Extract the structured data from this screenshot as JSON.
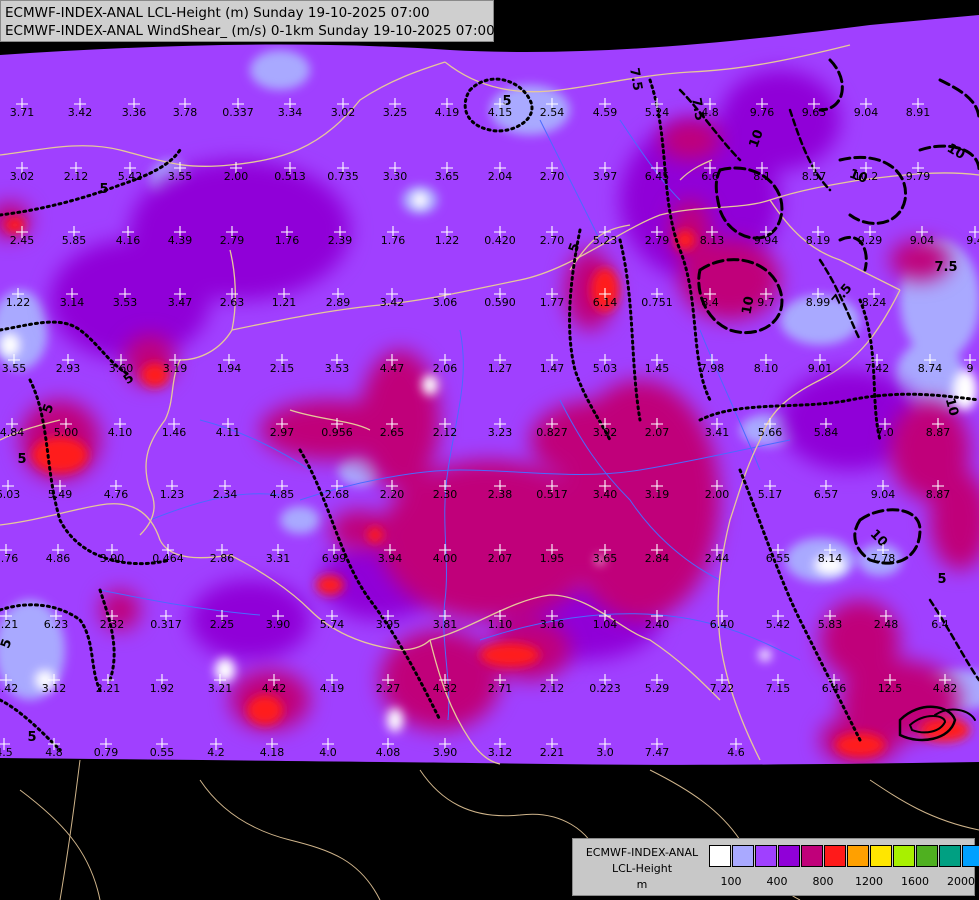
{
  "title": {
    "line1": "ECMWF-INDEX-ANAL LCL-Height (m) Sunday 19-10-2025 07:00",
    "line2": "ECMWF-INDEX-ANAL WindShear_ (m/s) 0-1km Sunday 19-10-2025 07:00"
  },
  "legend": {
    "line1": "ECMWF-INDEX-ANAL",
    "line2": "LCL-Height",
    "line3": "m",
    "colors": [
      "#ffffff",
      "#a9a9ff",
      "#a040ff",
      "#9000d8",
      "#c0007a",
      "#ff1a1a",
      "#ffa000",
      "#ffe600",
      "#a8f000",
      "#4fb020",
      "#00a082",
      "#00a0ff"
    ],
    "ticks": [
      "100",
      "400",
      "800",
      "1200",
      "1600",
      "2000"
    ]
  },
  "palette": {
    "no_data": "#000000",
    "purple": "#a040ff",
    "light": "#a9a9ff",
    "violet": "#9000d8",
    "magenta": "#c0007a",
    "red": "#ff1a1a",
    "border": "#e6c89a",
    "river": "#4a6aff"
  },
  "stations": [
    {
      "v": "3.71"
    },
    {
      "v": "3.42"
    },
    {
      "v": "3.36"
    },
    {
      "v": "3.78"
    },
    {
      "v": "0.337"
    },
    {
      "v": "3.34"
    },
    {
      "v": "3.02"
    },
    {
      "v": "3.25"
    },
    {
      "v": "4.19"
    },
    {
      "v": "4.15"
    },
    {
      "v": "2.54"
    },
    {
      "v": "4.59"
    },
    {
      "v": "5.24"
    },
    {
      "v": "4.8"
    },
    {
      "v": "9.76"
    },
    {
      "v": "9.63"
    },
    {
      "v": "9.04"
    },
    {
      "v": "8.91"
    },
    {
      "v": "3.02"
    },
    {
      "v": "2.12"
    },
    {
      "v": "5.42"
    },
    {
      "v": "3.55"
    },
    {
      "v": "2.00"
    },
    {
      "v": "0.513"
    },
    {
      "v": "0.735"
    },
    {
      "v": "3.30"
    },
    {
      "v": "3.65"
    },
    {
      "v": "2.04"
    },
    {
      "v": "2.70"
    },
    {
      "v": "3.97"
    },
    {
      "v": "6.45"
    },
    {
      "v": "6.6"
    },
    {
      "v": "8.1"
    },
    {
      "v": "8.57"
    },
    {
      "v": "10.2"
    },
    {
      "v": "9.79"
    },
    {
      "v": "2.45"
    },
    {
      "v": "5.85"
    },
    {
      "v": "4.16"
    },
    {
      "v": "4.39"
    },
    {
      "v": "2.79"
    },
    {
      "v": "1.76"
    },
    {
      "v": "2.39"
    },
    {
      "v": "1.76"
    },
    {
      "v": "1.22"
    },
    {
      "v": "0.420"
    },
    {
      "v": "2.70"
    },
    {
      "v": "5.23"
    },
    {
      "v": "2.79"
    },
    {
      "v": "8.13"
    },
    {
      "v": "9.94"
    },
    {
      "v": "8.19"
    },
    {
      "v": "9.29"
    },
    {
      "v": "9.04"
    },
    {
      "v": "9.4"
    },
    {
      "v": "1.22"
    },
    {
      "v": "3.14"
    },
    {
      "v": "3.53"
    },
    {
      "v": "3.47"
    },
    {
      "v": "2.63"
    },
    {
      "v": "1.21"
    },
    {
      "v": "2.89"
    },
    {
      "v": "3.42"
    },
    {
      "v": "3.06"
    },
    {
      "v": "0.590"
    },
    {
      "v": "1.77"
    },
    {
      "v": "6.14"
    },
    {
      "v": "0.751"
    },
    {
      "v": "8.4"
    },
    {
      "v": "9.7"
    },
    {
      "v": "8.99"
    },
    {
      "v": "8.24"
    },
    {
      "v": "3.55"
    },
    {
      "v": "2.93"
    },
    {
      "v": "3.60"
    },
    {
      "v": "3.19"
    },
    {
      "v": "1.94"
    },
    {
      "v": "2.15"
    },
    {
      "v": "3.53"
    },
    {
      "v": "4.47"
    },
    {
      "v": "2.06"
    },
    {
      "v": "1.27"
    },
    {
      "v": "1.47"
    },
    {
      "v": "5.03"
    },
    {
      "v": "1.45"
    },
    {
      "v": "7.98"
    },
    {
      "v": "8.10"
    },
    {
      "v": "9.01"
    },
    {
      "v": "7.42"
    },
    {
      "v": "8.74"
    },
    {
      "v": "9"
    },
    {
      "v": "4.84"
    },
    {
      "v": "5.00"
    },
    {
      "v": "4.10"
    },
    {
      "v": "1.46"
    },
    {
      "v": "4.11"
    },
    {
      "v": "2.97"
    },
    {
      "v": "0.956"
    },
    {
      "v": "2.65"
    },
    {
      "v": "2.12"
    },
    {
      "v": "3.23"
    },
    {
      "v": "0.827"
    },
    {
      "v": "3.92"
    },
    {
      "v": "2.07"
    },
    {
      "v": "3.41"
    },
    {
      "v": "5.66"
    },
    {
      "v": "5.84"
    },
    {
      "v": "7.0"
    },
    {
      "v": "8.87"
    },
    {
      "v": "6.03"
    },
    {
      "v": "5.49"
    },
    {
      "v": "4.76"
    },
    {
      "v": "1.23"
    },
    {
      "v": "2.34"
    },
    {
      "v": "4.85"
    },
    {
      "v": "2.68"
    },
    {
      "v": "2.20"
    },
    {
      "v": "2.30"
    },
    {
      "v": "2.38"
    },
    {
      "v": "0.517"
    },
    {
      "v": "3.40"
    },
    {
      "v": "3.19"
    },
    {
      "v": "2.00"
    },
    {
      "v": "5.17"
    },
    {
      "v": "6.57"
    },
    {
      "v": "9.04"
    },
    {
      "v": "8.87"
    },
    {
      "v": "6.76"
    },
    {
      "v": "4.86"
    },
    {
      "v": "3.90"
    },
    {
      "v": "0.464"
    },
    {
      "v": "2.86"
    },
    {
      "v": "3.31"
    },
    {
      "v": "6.99"
    },
    {
      "v": "3.94"
    },
    {
      "v": "4.00"
    },
    {
      "v": "2.07"
    },
    {
      "v": "1.95"
    },
    {
      "v": "3.65"
    },
    {
      "v": "2.84"
    },
    {
      "v": "2.44"
    },
    {
      "v": "6.55"
    },
    {
      "v": "8.14"
    },
    {
      "v": "7.78"
    },
    {
      "v": "5.21"
    },
    {
      "v": "6.23"
    },
    {
      "v": "2.32"
    },
    {
      "v": "0.317"
    },
    {
      "v": "2.25"
    },
    {
      "v": "3.90"
    },
    {
      "v": "5.74"
    },
    {
      "v": "3.95"
    },
    {
      "v": "3.81"
    },
    {
      "v": "1.10"
    },
    {
      "v": "3.16"
    },
    {
      "v": "1.04"
    },
    {
      "v": "2.40"
    },
    {
      "v": "6.40"
    },
    {
      "v": "5.42"
    },
    {
      "v": "5.83"
    },
    {
      "v": "2.48"
    },
    {
      "v": "6.4"
    },
    {
      "v": "4.42"
    },
    {
      "v": "3.12"
    },
    {
      "v": "2.21"
    },
    {
      "v": "1.92"
    },
    {
      "v": "3.21"
    },
    {
      "v": "4.42"
    },
    {
      "v": "4.19"
    },
    {
      "v": "2.27"
    },
    {
      "v": "4.32"
    },
    {
      "v": "2.71"
    },
    {
      "v": "2.12"
    },
    {
      "v": "0.223"
    },
    {
      "v": "5.29"
    },
    {
      "v": "7.22"
    },
    {
      "v": "7.15"
    },
    {
      "v": "6.46"
    },
    {
      "v": "12.5"
    },
    {
      "v": "4.82"
    },
    {
      "v": "4.5"
    },
    {
      "v": "4.8"
    },
    {
      "v": "0.79"
    },
    {
      "v": "0.55"
    },
    {
      "v": "4.2"
    },
    {
      "v": "4.18"
    },
    {
      "v": "4.0"
    },
    {
      "v": "4.08"
    },
    {
      "v": "3.90"
    },
    {
      "v": "3.12"
    },
    {
      "v": "2.21"
    },
    {
      "v": "3.0"
    },
    {
      "v": "7.47"
    },
    {
      "v": "4.6"
    }
  ],
  "contour_labels": [
    "5",
    "5",
    "5",
    "5",
    "5",
    "5",
    "5",
    "5",
    "5",
    "7.5",
    "7.5",
    "7.5",
    "7.5",
    "10",
    "10",
    "10",
    "10",
    "10",
    "10"
  ]
}
